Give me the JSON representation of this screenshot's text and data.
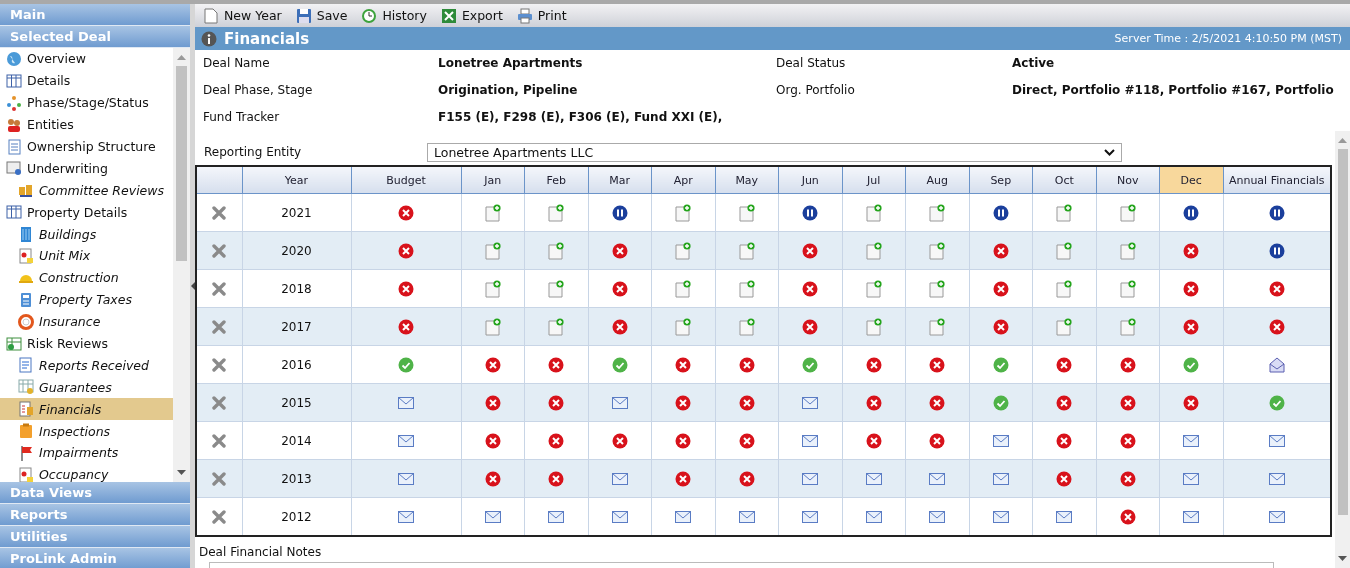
{
  "sidebar": {
    "sections": [
      {
        "title": "Main"
      },
      {
        "title": "Selected Deal",
        "items": [
          {
            "label": "Overview",
            "selected": false
          },
          {
            "label": "Details",
            "selected": false
          },
          {
            "label": "Phase/Stage/Status",
            "selected": false
          },
          {
            "label": "Entities",
            "selected": false
          },
          {
            "label": "Ownership Structure",
            "selected": false
          },
          {
            "label": "Underwriting",
            "selected": false,
            "children": [
              {
                "label": "Committee Reviews",
                "selected": false
              }
            ]
          },
          {
            "label": "Property Details",
            "selected": false,
            "children": [
              {
                "label": "Buildings",
                "selected": false
              },
              {
                "label": "Unit Mix",
                "selected": false
              },
              {
                "label": "Construction",
                "selected": false
              },
              {
                "label": "Property Taxes",
                "selected": false
              },
              {
                "label": "Insurance",
                "selected": false
              }
            ]
          },
          {
            "label": "Risk Reviews",
            "selected": false,
            "children": [
              {
                "label": "Reports Received",
                "selected": false
              },
              {
                "label": "Guarantees",
                "selected": false
              },
              {
                "label": "Financials",
                "selected": true
              },
              {
                "label": "Inspections",
                "selected": false
              },
              {
                "label": "Impairments",
                "selected": false
              },
              {
                "label": "Occupancy",
                "selected": false
              }
            ]
          }
        ]
      },
      {
        "title": "Data Views"
      },
      {
        "title": "Reports"
      },
      {
        "title": "Utilities"
      },
      {
        "title": "ProLink Admin"
      }
    ]
  },
  "toolbar": [
    {
      "label": "New Year"
    },
    {
      "label": "Save"
    },
    {
      "label": "History"
    },
    {
      "label": "Export"
    },
    {
      "label": "Print"
    }
  ],
  "title_bar": {
    "title": "Financials",
    "server_time": "Server Time : 2/5/2021 4:10:50 PM (MST)"
  },
  "deal_fields": [
    {
      "label": "Deal Name",
      "value": "Lonetree Apartments"
    },
    {
      "label": "Deal Status",
      "value": "Active"
    },
    {
      "label": "Deal Phase, Stage",
      "value": "Origination, Pipeline"
    },
    {
      "label": "Org. Portfolio",
      "value": "Direct, Portfolio #118, Portfolio #167, Portfolio"
    },
    {
      "label": "Fund Tracker",
      "value": "F155 (E), F298 (E), F306 (E), Fund XXI (E),"
    }
  ],
  "reporting_entity": {
    "label": "Reporting Entity",
    "value": "Lonetree Apartments LLC"
  },
  "table": {
    "columns": [
      {
        "label": "Year",
        "highlighted": false
      },
      {
        "label": "Budget",
        "highlighted": false
      },
      {
        "label": "Jan",
        "highlighted": false
      },
      {
        "label": "Feb",
        "highlighted": false
      },
      {
        "label": "Mar",
        "highlighted": false
      },
      {
        "label": "Apr",
        "highlighted": false
      },
      {
        "label": "May",
        "highlighted": false
      },
      {
        "label": "Jun",
        "highlighted": false
      },
      {
        "label": "Jul",
        "highlighted": false
      },
      {
        "label": "Aug",
        "highlighted": false
      },
      {
        "label": "Sep",
        "highlighted": false
      },
      {
        "label": "Oct",
        "highlighted": false
      },
      {
        "label": "Nov",
        "highlighted": false
      },
      {
        "label": "Dec",
        "highlighted": true
      },
      {
        "label": "Annual Financials",
        "highlighted": false
      }
    ],
    "rows": [
      {
        "year": "2021",
        "cells": [
          {
            "kind": "rejected"
          },
          {
            "kind": "new"
          },
          {
            "kind": "new"
          },
          {
            "kind": "pending"
          },
          {
            "kind": "new"
          },
          {
            "kind": "new"
          },
          {
            "kind": "pending"
          },
          {
            "kind": "new"
          },
          {
            "kind": "new"
          },
          {
            "kind": "pending"
          },
          {
            "kind": "new"
          },
          {
            "kind": "new"
          },
          {
            "kind": "pending"
          },
          {
            "kind": "pending"
          }
        ]
      },
      {
        "year": "2020",
        "cells": [
          {
            "kind": "rejected"
          },
          {
            "kind": "new"
          },
          {
            "kind": "new"
          },
          {
            "kind": "rejected"
          },
          {
            "kind": "new"
          },
          {
            "kind": "new"
          },
          {
            "kind": "rejected"
          },
          {
            "kind": "new"
          },
          {
            "kind": "new"
          },
          {
            "kind": "rejected"
          },
          {
            "kind": "new"
          },
          {
            "kind": "new"
          },
          {
            "kind": "rejected"
          },
          {
            "kind": "pending"
          }
        ]
      },
      {
        "year": "2018",
        "cells": [
          {
            "kind": "rejected"
          },
          {
            "kind": "new"
          },
          {
            "kind": "new"
          },
          {
            "kind": "rejected"
          },
          {
            "kind": "new"
          },
          {
            "kind": "new"
          },
          {
            "kind": "rejected"
          },
          {
            "kind": "new"
          },
          {
            "kind": "new"
          },
          {
            "kind": "rejected"
          },
          {
            "kind": "new"
          },
          {
            "kind": "new"
          },
          {
            "kind": "rejected"
          },
          {
            "kind": "rejected"
          }
        ]
      },
      {
        "year": "2017",
        "cells": [
          {
            "kind": "rejected"
          },
          {
            "kind": "new"
          },
          {
            "kind": "new"
          },
          {
            "kind": "rejected"
          },
          {
            "kind": "new"
          },
          {
            "kind": "new"
          },
          {
            "kind": "rejected"
          },
          {
            "kind": "new"
          },
          {
            "kind": "new"
          },
          {
            "kind": "rejected"
          },
          {
            "kind": "new"
          },
          {
            "kind": "new"
          },
          {
            "kind": "rejected"
          },
          {
            "kind": "rejected"
          }
        ]
      },
      {
        "year": "2016",
        "cells": [
          {
            "kind": "approved"
          },
          {
            "kind": "rejected"
          },
          {
            "kind": "rejected"
          },
          {
            "kind": "approved"
          },
          {
            "kind": "rejected"
          },
          {
            "kind": "rejected"
          },
          {
            "kind": "approved"
          },
          {
            "kind": "rejected"
          },
          {
            "kind": "rejected"
          },
          {
            "kind": "approved"
          },
          {
            "kind": "rejected"
          },
          {
            "kind": "rejected"
          },
          {
            "kind": "approved"
          },
          {
            "kind": "opened"
          }
        ]
      },
      {
        "year": "2015",
        "cells": [
          {
            "kind": "mail"
          },
          {
            "kind": "rejected"
          },
          {
            "kind": "rejected"
          },
          {
            "kind": "mail"
          },
          {
            "kind": "rejected"
          },
          {
            "kind": "rejected"
          },
          {
            "kind": "mail"
          },
          {
            "kind": "rejected"
          },
          {
            "kind": "rejected"
          },
          {
            "kind": "approved"
          },
          {
            "kind": "rejected"
          },
          {
            "kind": "rejected"
          },
          {
            "kind": "rejected"
          },
          {
            "kind": "approved"
          }
        ]
      },
      {
        "year": "2014",
        "cells": [
          {
            "kind": "mail"
          },
          {
            "kind": "rejected"
          },
          {
            "kind": "rejected"
          },
          {
            "kind": "rejected"
          },
          {
            "kind": "rejected"
          },
          {
            "kind": "rejected"
          },
          {
            "kind": "mail"
          },
          {
            "kind": "rejected"
          },
          {
            "kind": "rejected"
          },
          {
            "kind": "mail"
          },
          {
            "kind": "rejected"
          },
          {
            "kind": "rejected"
          },
          {
            "kind": "mail"
          },
          {
            "kind": "mail"
          }
        ]
      },
      {
        "year": "2013",
        "cells": [
          {
            "kind": "mail"
          },
          {
            "kind": "rejected"
          },
          {
            "kind": "rejected"
          },
          {
            "kind": "mail"
          },
          {
            "kind": "rejected"
          },
          {
            "kind": "rejected"
          },
          {
            "kind": "mail"
          },
          {
            "kind": "mail"
          },
          {
            "kind": "mail"
          },
          {
            "kind": "mail"
          },
          {
            "kind": "rejected"
          },
          {
            "kind": "rejected"
          },
          {
            "kind": "mail"
          },
          {
            "kind": "mail"
          }
        ]
      },
      {
        "year": "2012",
        "cells": [
          {
            "kind": "mail"
          },
          {
            "kind": "mail"
          },
          {
            "kind": "mail"
          },
          {
            "kind": "mail"
          },
          {
            "kind": "mail"
          },
          {
            "kind": "mail"
          },
          {
            "kind": "mail"
          },
          {
            "kind": "mail"
          },
          {
            "kind": "mail"
          },
          {
            "kind": "mail"
          },
          {
            "kind": "mail"
          },
          {
            "kind": "rejected"
          },
          {
            "kind": "mail"
          },
          {
            "kind": "mail"
          }
        ]
      }
    ]
  },
  "notes": {
    "label": "Deal Financial Notes"
  }
}
